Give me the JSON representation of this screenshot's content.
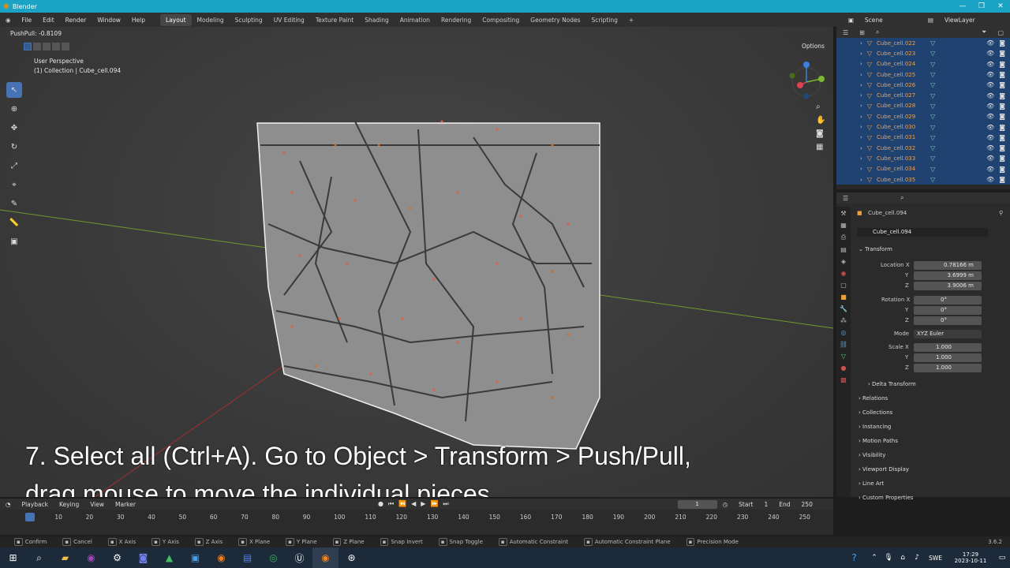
{
  "window": {
    "title": "Blender",
    "controls": [
      "—",
      "❐",
      "✕"
    ]
  },
  "menus": [
    "File",
    "Edit",
    "Render",
    "Window",
    "Help"
  ],
  "workspaces": [
    "Layout",
    "Modeling",
    "Sculpting",
    "UV Editing",
    "Texture Paint",
    "Shading",
    "Animation",
    "Rendering",
    "Compositing",
    "Geometry Nodes",
    "Scripting",
    "+"
  ],
  "active_workspace": "Layout",
  "scene": {
    "label": "Scene",
    "viewlayer": "ViewLayer"
  },
  "viewport": {
    "operator": "PushPull: -0.8109",
    "view_name": "User Perspective",
    "collection": "(1) Collection | Cube_cell.094",
    "options": "Options",
    "caption_line1": "7. Select all (Ctrl+A). Go to Object > Transform > Push/Pull,",
    "caption_line2": "drag mouse to move the individual pieces"
  },
  "outliner": {
    "items": [
      "Cube_cell.022",
      "Cube_cell.023",
      "Cube_cell.024",
      "Cube_cell.025",
      "Cube_cell.026",
      "Cube_cell.027",
      "Cube_cell.028",
      "Cube_cell.029",
      "Cube_cell.030",
      "Cube_cell.031",
      "Cube_cell.032",
      "Cube_cell.033",
      "Cube_cell.034",
      "Cube_cell.035"
    ]
  },
  "properties": {
    "object_name": "Cube_cell.094",
    "data_name": "Cube_cell.094",
    "transform_label": "Transform",
    "location_label": "Location X",
    "location": [
      "0.78166 m",
      "3.6999 m",
      "3.9006 m"
    ],
    "rotation_label": "Rotation X",
    "rotation": [
      "0°",
      "0°",
      "0°"
    ],
    "mode_label": "Mode",
    "mode": "XYZ Euler",
    "scale_label": "Scale X",
    "scale": [
      "1.000",
      "1.000",
      "1.000"
    ],
    "y_label": "Y",
    "z_label": "Z",
    "delta": "Delta Transform",
    "sections": [
      "Relations",
      "Collections",
      "Instancing",
      "Motion Paths",
      "Visibility",
      "Viewport Display",
      "Line Art",
      "Custom Properties"
    ]
  },
  "timeline": {
    "menus": [
      "Playback",
      "Keying",
      "View",
      "Marker"
    ],
    "current_frame": "1",
    "start_label": "Start",
    "start": "1",
    "end_label": "End",
    "end": "250",
    "ticks": [
      "1",
      "10",
      "20",
      "30",
      "40",
      "50",
      "60",
      "70",
      "80",
      "90",
      "100",
      "110",
      "120",
      "130",
      "140",
      "150",
      "160",
      "170",
      "180",
      "190",
      "200",
      "210",
      "220",
      "230",
      "240",
      "250"
    ]
  },
  "statusbar": [
    "Confirm",
    "Cancel",
    "X Axis",
    "Y Axis",
    "Z Axis",
    "X Plane",
    "Y Plane",
    "Z Plane",
    "Snap Invert",
    "Snap Toggle",
    "Automatic Constraint",
    "Automatic Constraint Plane",
    "Precision Mode"
  ],
  "version": "3.6.2",
  "taskbar": {
    "lang": "SWE",
    "time": "17:29",
    "date": "2023-10-11"
  }
}
